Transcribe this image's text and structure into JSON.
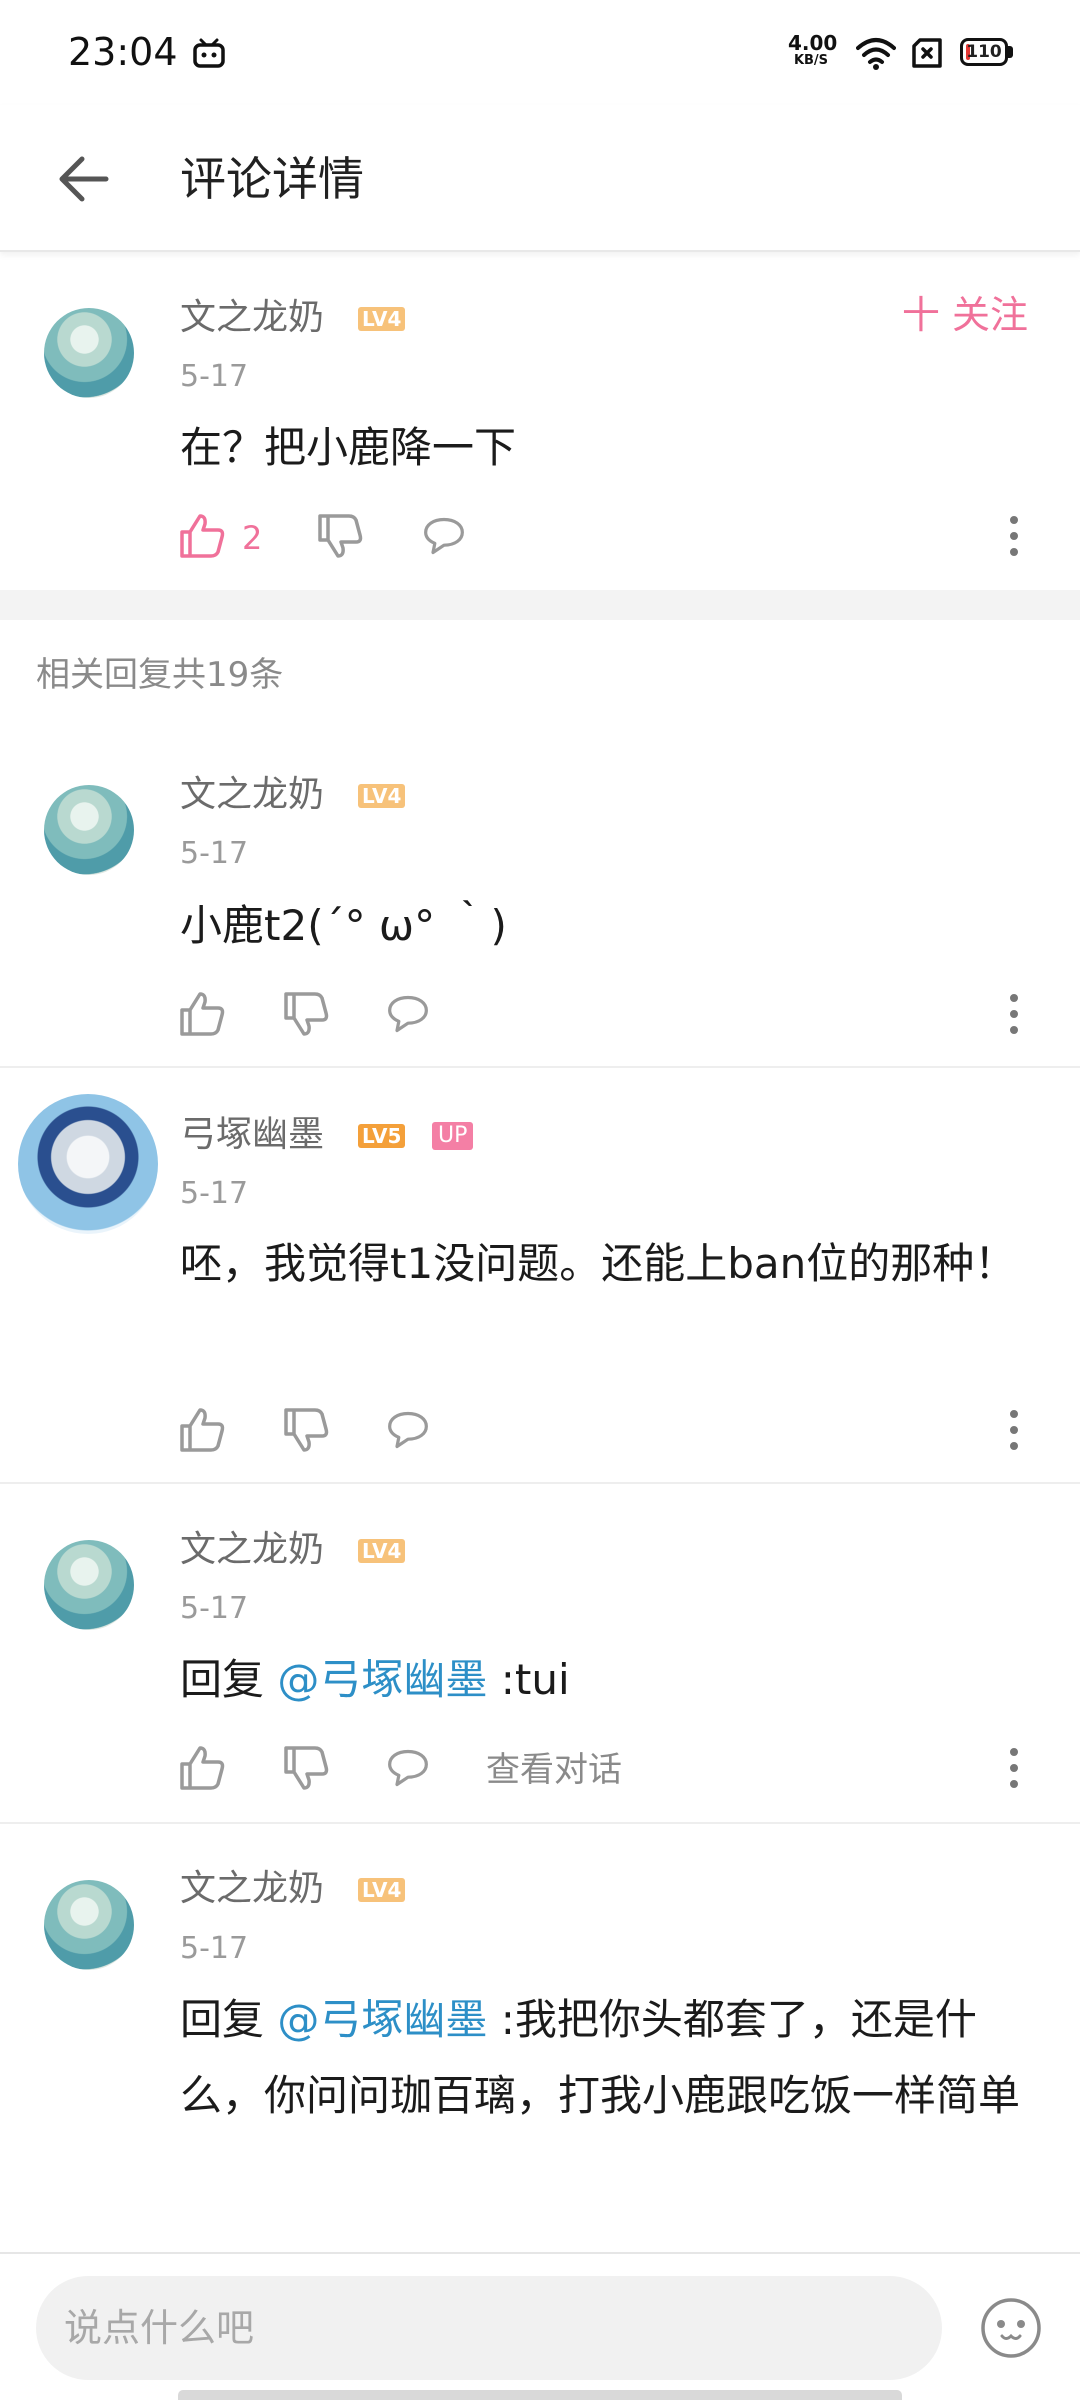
{
  "status_bar": {
    "time": "23:04",
    "net_speed_value": "4.00",
    "net_speed_unit": "KB/S",
    "battery": "110"
  },
  "header": {
    "title": "评论详情"
  },
  "main_comment": {
    "user": "文之龙奶",
    "level": "LV4",
    "date": "5-17",
    "text": "在？把小鹿降一下",
    "likes": "2",
    "follow_label": "十 关注"
  },
  "replies_header": "相关回复共19条",
  "replies": [
    {
      "user": "文之龙奶",
      "level": "LV4",
      "date": "5-17",
      "text": "小鹿t2(´° ω° ｀)"
    },
    {
      "user": "弓塚幽墨",
      "level": "LV5",
      "badge": "UP",
      "date": "5-17",
      "text": "呸，我觉得t1没问题。还能上ban位的那种！"
    },
    {
      "user": "文之龙奶",
      "level": "LV4",
      "date": "5-17",
      "reply_prefix": "回复 ",
      "mention": "@弓塚幽墨",
      "text": " :tui",
      "view_conversation": "查看对话"
    },
    {
      "user": "文之龙奶",
      "level": "LV4",
      "date": "5-17",
      "reply_prefix": "回复 ",
      "mention": "@弓塚幽墨",
      "text": " :我把你头都套了，还是什么，你问问珈百璃，打我小鹿跟吃饭一样简单"
    }
  ],
  "composer": {
    "placeholder": "说点什么吧"
  },
  "colors": {
    "accent_pink": "#f0719a",
    "mention_blue": "#2d8fc7",
    "level4": "#f7c27a",
    "level5": "#f4a03a"
  }
}
